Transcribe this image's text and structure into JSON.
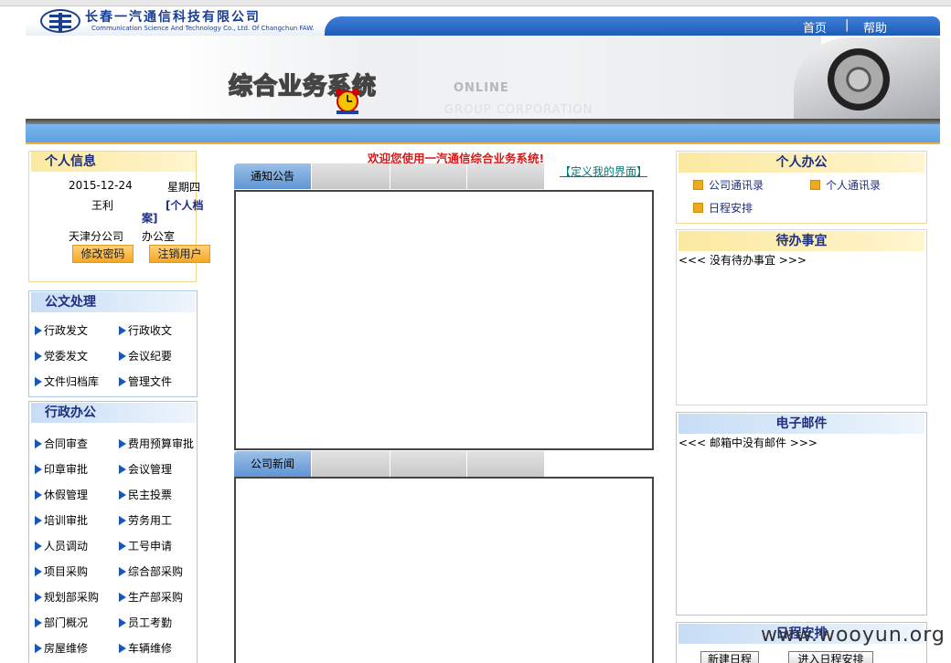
{
  "header": {
    "company_cn": "长春一汽通信科技有限公司",
    "company_en": "Communication Science And Technology Co., Ltd. Of Changchun FAW.",
    "nav_home": "首页",
    "nav_sep": "|",
    "nav_help": "帮助",
    "system_title": "综合业务系统",
    "banner_online": "ONLINE",
    "banner_corp": "GROUP CORPORATION"
  },
  "welcome": "欢迎您使用一汽通信综合业务系统!",
  "customize_link": "【定义我的界面】",
  "personal_info": {
    "title": "个人信息",
    "date": "2015-12-24",
    "weekday": "星期四",
    "name": "王利",
    "profile_link_1": "[个人档",
    "profile_link_2": "案]",
    "branch": "天津分公司",
    "office": "办公室",
    "change_pwd": "修改密码",
    "logout": "注销用户"
  },
  "doc_processing": {
    "title": "公文处理",
    "items": [
      "行政发文",
      "行政收文",
      "党委发文",
      "会议纪要",
      "文件归档库",
      "管理文件"
    ]
  },
  "admin_office": {
    "title": "行政办公",
    "items": [
      "合同审查",
      "费用预算审批",
      "印章审批",
      "会议管理",
      "休假管理",
      "民主投票",
      "培训审批",
      "劳务用工",
      "人员调动",
      "工号申请",
      "项目采购",
      "综合部采购",
      "规划部采购",
      "生产部采购",
      "部门概况",
      "员工考勤",
      "房屋维修",
      "车辆维修"
    ]
  },
  "notice": {
    "tab": "通知公告"
  },
  "news": {
    "tab": "公司新闻"
  },
  "personal_office": {
    "title": "个人办公",
    "items": [
      "公司通讯录",
      "个人通讯录",
      "日程安排"
    ]
  },
  "todo": {
    "title": "待办事宜",
    "empty": "<<< 没有待办事宜 >>>"
  },
  "email": {
    "title": "电子邮件",
    "empty": "<<< 邮箱中没有邮件 >>>"
  },
  "schedule": {
    "title": "日程安排",
    "new_btn": "新建日程",
    "enter_btn": "进入日程安排"
  },
  "watermark": "www.wooyun.org",
  "colors": {
    "accent_blue": "#1d5cb8",
    "panel_yellow": "#fbe9a0",
    "link_blue": "#1f2f80",
    "welcome_red": "#d41a1a"
  }
}
